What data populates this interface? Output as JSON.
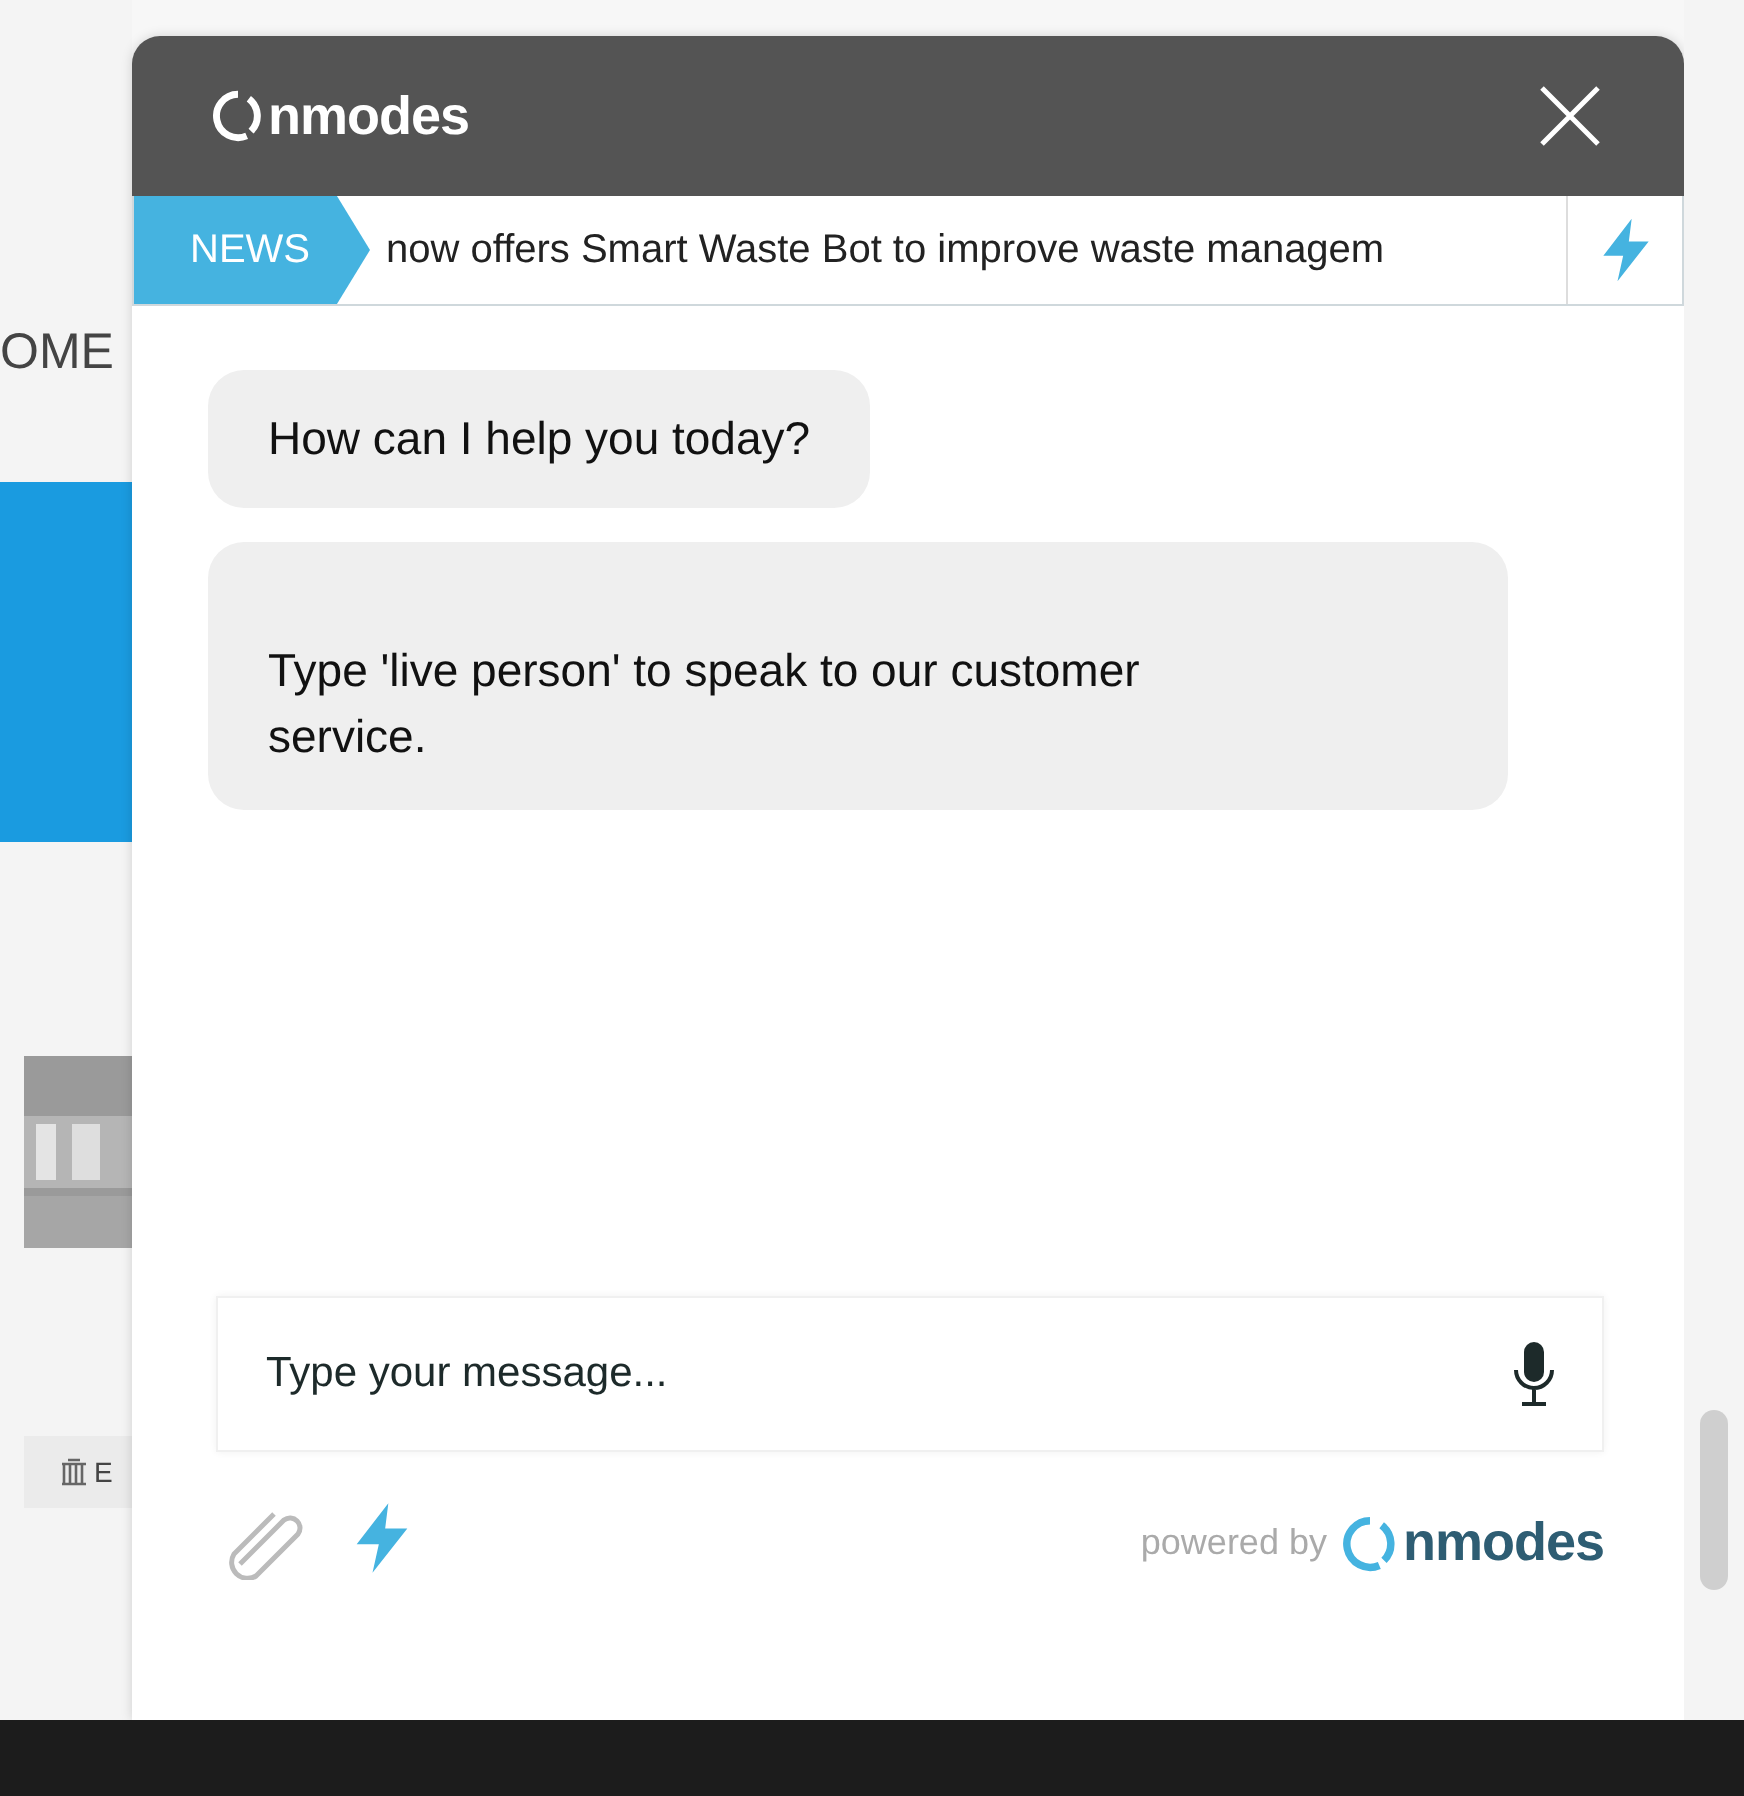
{
  "background_page": {
    "heading": "OME",
    "chip": "E"
  },
  "chat": {
    "brand": "nmodes",
    "news": {
      "tag": "NEWS",
      "text": "now offers Smart Waste Bot to improve waste managem"
    },
    "messages": [
      {
        "text": "How can I help you today?"
      },
      {
        "text": "Type 'live person' to speak to our customer service."
      }
    ],
    "input": {
      "placeholder": "Type your message..."
    },
    "footer": {
      "powered_by": "powered by",
      "brand": "nmodes"
    }
  }
}
